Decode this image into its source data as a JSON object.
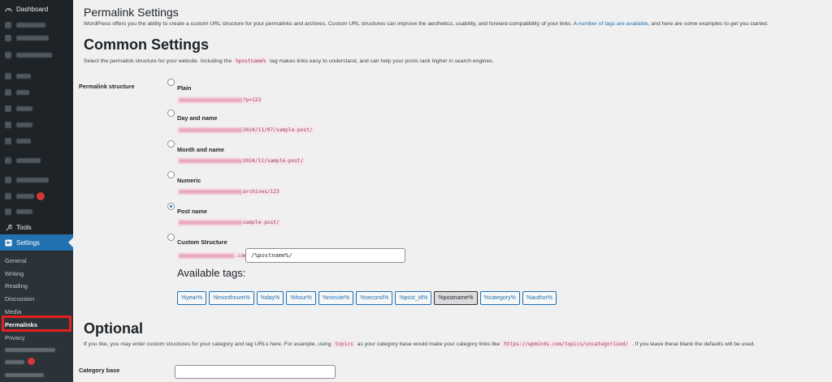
{
  "sidebar": {
    "dashboard": "Dashboard",
    "tools": "Tools",
    "settings": "Settings",
    "submenu": {
      "general": "General",
      "writing": "Writing",
      "reading": "Reading",
      "discussion": "Discussion",
      "media": "Media",
      "permalinks": "Permalinks",
      "privacy": "Privacy"
    }
  },
  "header": {
    "title": "Permalink Settings",
    "intro_before": "WordPress offers you the ability to create a custom URL structure for your permalinks and archives. Custom URL structures can improve the aesthetics, usability, and forward-compatibility of your links. A ",
    "intro_link": "number of tags are available",
    "intro_after": ", and here are some examples to get you started."
  },
  "common": {
    "heading": "Common Settings",
    "desc_before": "Select the permalink structure for your website. Including the",
    "desc_code": "%postname%",
    "desc_after": "tag makes links easy to understand, and can help your posts rank higher in search engines.",
    "row_label": "Permalink structure",
    "options": [
      {
        "label": "Plain",
        "example": "?p=123",
        "checked": false
      },
      {
        "label": "Day and name",
        "example": "2024/11/07/sample-post/",
        "checked": false
      },
      {
        "label": "Month and name",
        "example": "2024/11/sample-post/",
        "checked": false
      },
      {
        "label": "Numeric",
        "example": "archives/123",
        "checked": false
      },
      {
        "label": "Post name",
        "example": "sample-post/",
        "checked": true
      },
      {
        "label": "Custom Structure",
        "example": ".com",
        "checked": false
      }
    ],
    "custom_value": "/%postname%/",
    "available_tags_label": "Available tags:",
    "tags": [
      "%year%",
      "%monthnum%",
      "%day%",
      "%hour%",
      "%minute%",
      "%second%",
      "%post_id%",
      "%postname%",
      "%category%",
      "%author%"
    ],
    "pressed_tag": "%postname%"
  },
  "optional": {
    "heading": "Optional",
    "desc_before": "If you like, you may enter custom structures for your category and tag URLs here. For example, using",
    "desc_code1": "topics",
    "desc_middle": "as your category base would make your category links like",
    "desc_code2": "https://wpminds.com/topics/uncategorized/",
    "desc_after": ". If you leave these blank the defaults will be used.",
    "category_base_label": "Category base"
  }
}
